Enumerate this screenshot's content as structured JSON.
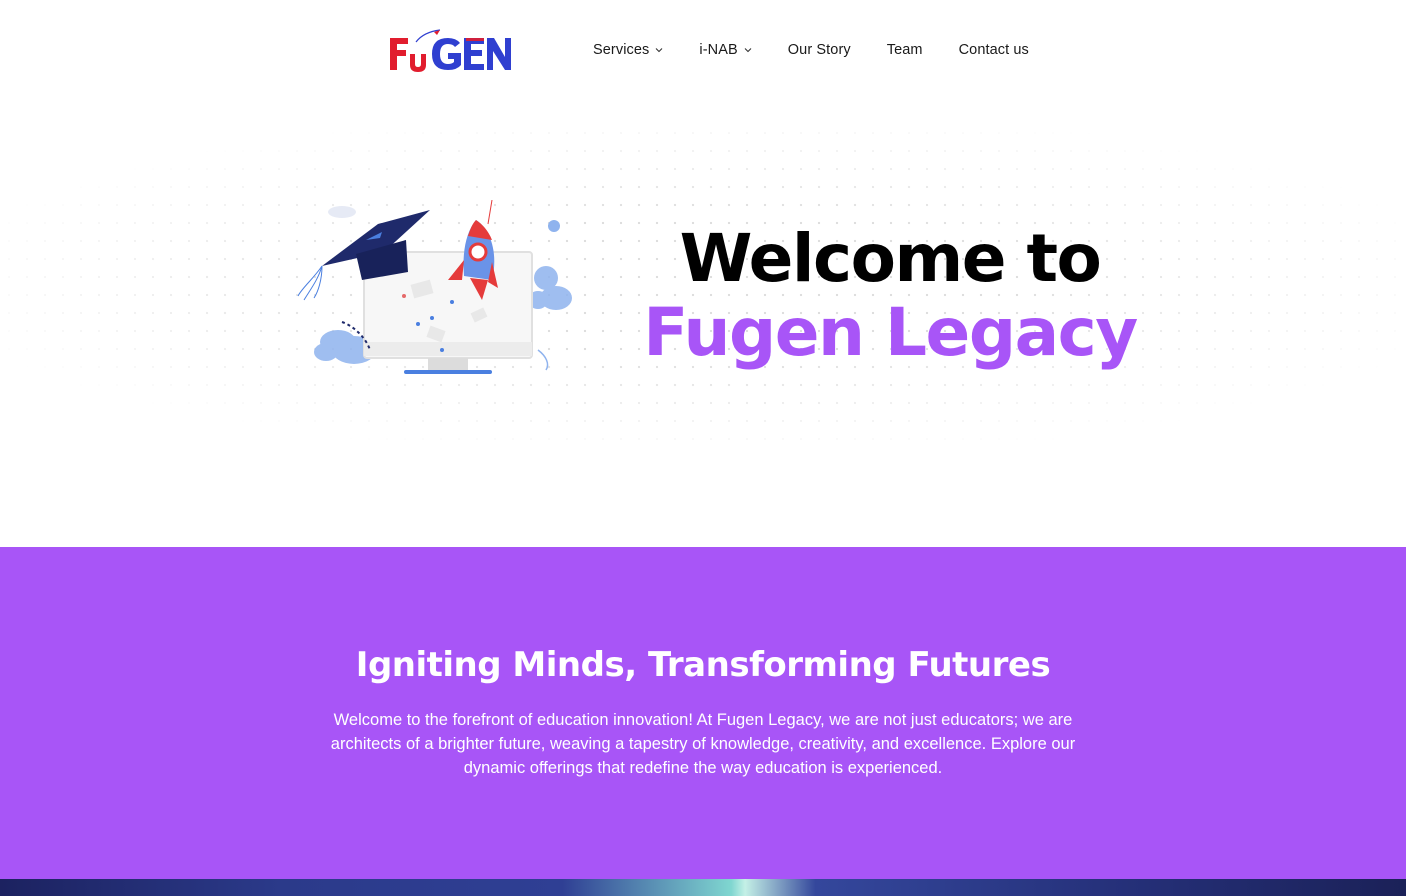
{
  "brand": {
    "logo_text": "FuGEN",
    "colors": {
      "red": "#e11d2e",
      "blue": "#2f3fd0",
      "purple": "#a855f7"
    }
  },
  "nav": {
    "items": [
      {
        "label": "Services",
        "has_dropdown": true
      },
      {
        "label": "i-NAB",
        "has_dropdown": true
      },
      {
        "label": "Our Story",
        "has_dropdown": false
      },
      {
        "label": "Team",
        "has_dropdown": false
      },
      {
        "label": "Contact us",
        "has_dropdown": false
      }
    ]
  },
  "hero": {
    "line1": "Welcome to",
    "line2": "Fugen Legacy",
    "illustration_icons": [
      "graduation-cap-icon",
      "rocket-icon",
      "monitor-icon"
    ]
  },
  "intro": {
    "heading": "Igniting Minds, Transforming Futures",
    "body": "Welcome to the forefront of education innovation! At Fugen Legacy, we are not just educators; we are architects of a brighter future, weaving a tapestry of knowledge, creativity, and excellence. Explore our dynamic offerings that redefine the way education is experienced."
  }
}
